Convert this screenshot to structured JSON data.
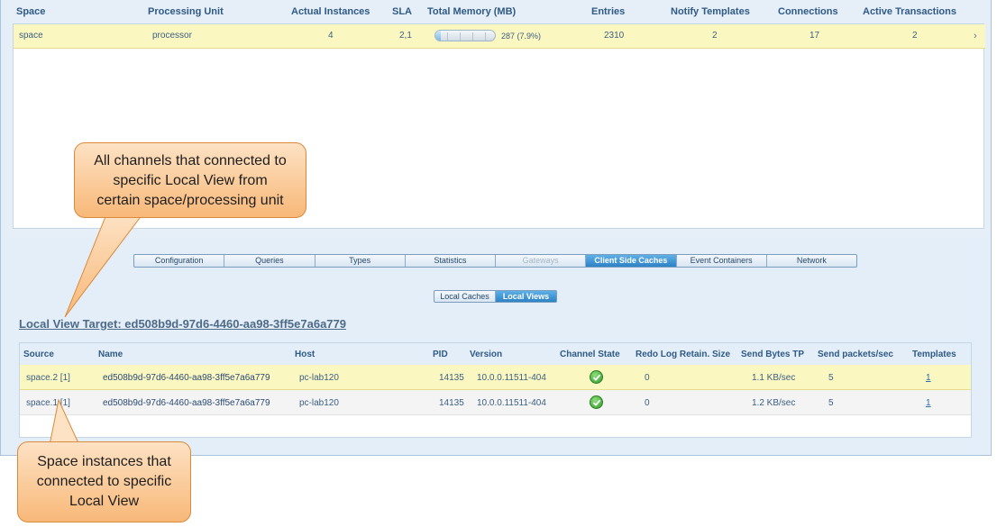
{
  "spaces_grid": {
    "columns": [
      "Space",
      "Processing Unit",
      "Actual Instances",
      "SLA",
      "Total Memory (MB)",
      "Entries",
      "Notify Templates",
      "Connections",
      "Active Transactions"
    ],
    "rows": [
      {
        "space": "space",
        "processing_unit": "processor",
        "actual_instances": "4",
        "sla": "2,1",
        "total_memory": "287 (7.9%)",
        "memory_fraction": 0.079,
        "entries": "2310",
        "notify_templates": "2",
        "connections": "17",
        "active_transactions": "2"
      }
    ]
  },
  "detail_tabs": [
    "Configuration",
    "Queries",
    "Types",
    "Statistics",
    "Gateways",
    "Client Side Caches",
    "Event Containers",
    "Network"
  ],
  "detail_tabs_active": "Client Side Caches",
  "detail_tabs_disabled": "Gateways",
  "cache_tabs": [
    "Local Caches",
    "Local Views"
  ],
  "cache_tabs_active": "Local Views",
  "local_view_target": "Local View Target: ed508b9d-97d6-4460-aa98-3ff5e7a6a779",
  "channels_table": {
    "columns": [
      "Source",
      "Name",
      "Host",
      "PID",
      "Version",
      "Channel State",
      "Redo Log Retain. Size",
      "Send Bytes TP",
      "Send packets/sec",
      "Templates"
    ],
    "rows": [
      {
        "source": "space.2 [1]",
        "name": "ed508b9d-97d6-4460-aa98-3ff5e7a6a779",
        "host": "pc-lab120",
        "pid": "14135",
        "version": "10.0.0.11511-404",
        "channel_state": "ok",
        "redo_log": "0",
        "send_bytes": "1.1 KB/sec",
        "send_packets": "5",
        "templates": "1"
      },
      {
        "source": "space.1 [1]",
        "name": "ed508b9d-97d6-4460-aa98-3ff5e7a6a779",
        "host": "pc-lab120",
        "pid": "14135",
        "version": "10.0.0.11511-404",
        "channel_state": "ok",
        "redo_log": "0",
        "send_bytes": "1.2 KB/sec",
        "send_packets": "5",
        "templates": "1"
      }
    ]
  },
  "callouts": {
    "channels": [
      "All channels that connected to",
      "specific Local View from",
      "certain space/processing unit"
    ],
    "instances": [
      "Space instances that",
      "connected to specific",
      "Local View"
    ]
  },
  "colors": {
    "selected_row": "#fbf7c0",
    "header_text": "#2e5a86",
    "active_tab": "#2d82c6",
    "callout_fill": "#f8b878",
    "status_ok": "#2f9a2a"
  },
  "icons": {
    "channel_state_ok": "green-check-icon"
  }
}
